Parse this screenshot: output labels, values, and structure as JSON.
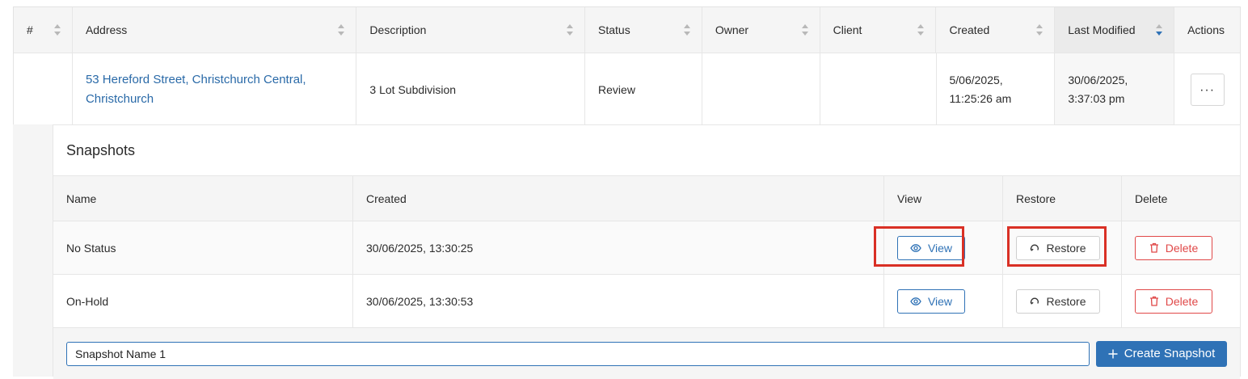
{
  "projects_table": {
    "columns": [
      "#",
      "Address",
      "Description",
      "Status",
      "Owner",
      "Client",
      "Created",
      "Last Modified",
      "Actions"
    ],
    "sorted_column": "Last Modified",
    "row": {
      "number": "",
      "address_line1": "53 Hereford Street, Christchurch Central,",
      "address_line2": "Christchurch",
      "description": "3 Lot Subdivision",
      "status": "Review",
      "owner": "",
      "client": "",
      "created_line1": "5/06/2025,",
      "created_line2": "11:25:26 am",
      "modified_line1": "30/06/2025,",
      "modified_line2": "3:37:03 pm",
      "actions_label": "···"
    }
  },
  "snapshots": {
    "title": "Snapshots",
    "columns": [
      "Name",
      "Created",
      "View",
      "Restore",
      "Delete"
    ],
    "rows": [
      {
        "name": "No Status",
        "created": "30/06/2025, 13:30:25",
        "view": "View",
        "restore": "Restore",
        "delete": "Delete"
      },
      {
        "name": "On-Hold",
        "created": "30/06/2025, 13:30:53",
        "view": "View",
        "restore": "Restore",
        "delete": "Delete"
      }
    ],
    "new_snapshot_value": "Snapshot Name 1",
    "create_label": "Create Snapshot"
  },
  "colors": {
    "accent": "#2f72b6",
    "danger": "#e04848",
    "highlight": "#d93025"
  },
  "icons": {
    "sort": "sort-icon",
    "view": "eye-icon",
    "restore": "restore-icon",
    "delete": "trash-icon",
    "create": "plus-icon"
  }
}
